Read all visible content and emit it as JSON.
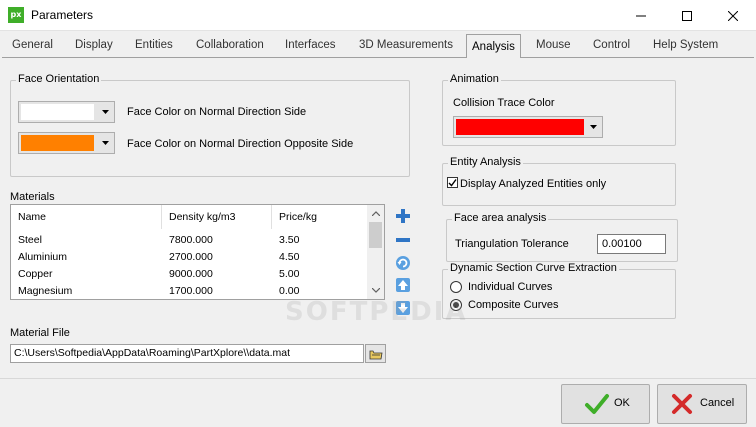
{
  "window": {
    "logo_text": "px",
    "title": "Parameters"
  },
  "tabs": [
    {
      "label": "General"
    },
    {
      "label": "Display"
    },
    {
      "label": "Entities"
    },
    {
      "label": "Collaboration"
    },
    {
      "label": "Interfaces"
    },
    {
      "label": "3D Measurements"
    },
    {
      "label": "Analysis",
      "active": true
    },
    {
      "label": "Mouse"
    },
    {
      "label": "Control"
    },
    {
      "label": "Help System"
    }
  ],
  "face_orientation": {
    "title": "Face Orientation",
    "normal_label": "Face Color on Normal Direction Side",
    "normal_color": "#ffffff",
    "opposite_label": "Face Color on Normal Direction Opposite Side",
    "opposite_color": "#ff8000"
  },
  "materials": {
    "title": "Materials",
    "columns": [
      "Name",
      "Density kg/m3",
      "Price/kg"
    ],
    "rows": [
      [
        "Steel",
        "7800.000",
        "3.50"
      ],
      [
        "Aluminium",
        "2700.000",
        "4.50"
      ],
      [
        "Copper",
        "9000.000",
        "5.00"
      ],
      [
        "Magnesium",
        "1700.000",
        "0.00"
      ]
    ]
  },
  "material_file": {
    "label": "Material File",
    "value": "C:\\Users\\Softpedia\\AppData\\Roaming\\PartXplore\\\\data.mat"
  },
  "animation": {
    "title": "Animation",
    "collision_label": "Collision Trace Color",
    "collision_color": "#ff0000"
  },
  "entity_analysis": {
    "title": "Entity Analysis",
    "display_label": "Display Analyzed Entities only",
    "display_checked": true
  },
  "face_area": {
    "title": "Face area analysis",
    "tolerance_label": "Triangulation Tolerance",
    "tolerance_value": "0.00100"
  },
  "dynamic_section": {
    "title": "Dynamic Section Curve Extraction",
    "options": [
      "Individual Curves",
      "Composite Curves"
    ],
    "selected": "Composite Curves"
  },
  "buttons": {
    "ok": "OK",
    "cancel": "Cancel"
  },
  "watermark": "SOFTPEDIA",
  "colors": {
    "accent_blue": "#2f75c5",
    "ok_green": "#3fae29",
    "cancel_red": "#d42a2a"
  }
}
